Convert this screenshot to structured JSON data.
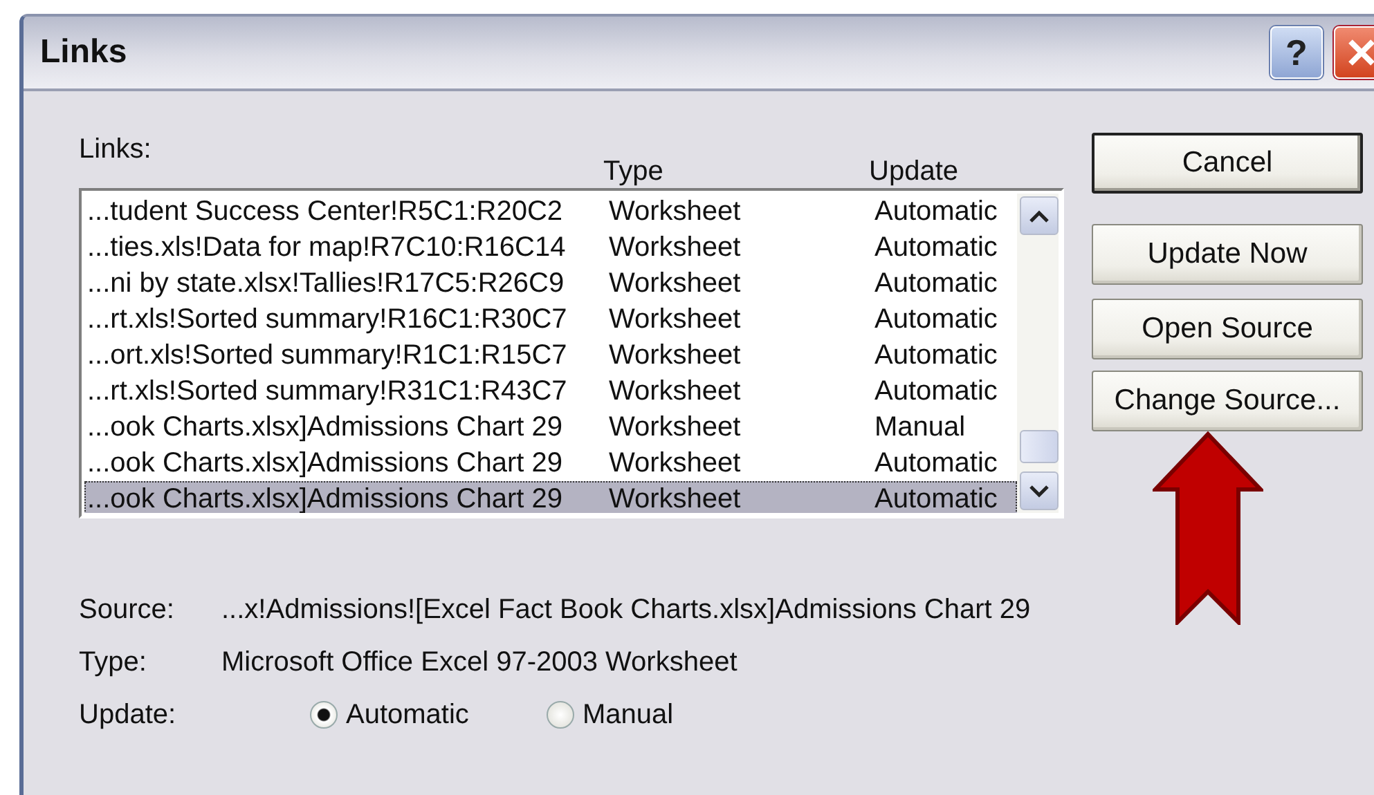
{
  "window": {
    "title": "Links",
    "help_button": "?"
  },
  "links_list": {
    "label": "Links:",
    "columns": [
      "Type",
      "Update"
    ],
    "rows": [
      {
        "link": "...tudent Success Center!R5C1:R20C2",
        "type": "Worksheet",
        "update": "Automatic",
        "selected": false
      },
      {
        "link": "...ties.xls!Data for map!R7C10:R16C14",
        "type": "Worksheet",
        "update": "Automatic",
        "selected": false
      },
      {
        "link": "...ni by state.xlsx!Tallies!R17C5:R26C9",
        "type": "Worksheet",
        "update": "Automatic",
        "selected": false
      },
      {
        "link": "...rt.xls!Sorted summary!R16C1:R30C7",
        "type": "Worksheet",
        "update": "Automatic",
        "selected": false
      },
      {
        "link": "...ort.xls!Sorted summary!R1C1:R15C7",
        "type": "Worksheet",
        "update": "Automatic",
        "selected": false
      },
      {
        "link": "...rt.xls!Sorted summary!R31C1:R43C7",
        "type": "Worksheet",
        "update": "Automatic",
        "selected": false
      },
      {
        "link": "...ook Charts.xlsx]Admissions Chart 29",
        "type": "Worksheet",
        "update": "Manual",
        "selected": false
      },
      {
        "link": "...ook Charts.xlsx]Admissions Chart 29",
        "type": "Worksheet",
        "update": "Automatic",
        "selected": false
      },
      {
        "link": "...ook Charts.xlsx]Admissions Chart 29",
        "type": "Worksheet",
        "update": "Automatic",
        "selected": true
      }
    ]
  },
  "buttons": [
    {
      "label": "Cancel",
      "default": true
    },
    {
      "label": "Update Now",
      "default": false
    },
    {
      "label": "Open Source",
      "default": false
    },
    {
      "label": "Change Source...",
      "default": false
    }
  ],
  "details": [
    {
      "label": "Source:",
      "value": "...x!Admissions![Excel Fact Book Charts.xlsx]Admissions Chart 29"
    },
    {
      "label": "Type:",
      "value": "Microsoft Office Excel 97-2003 Worksheet"
    }
  ],
  "update_option": {
    "label": "Update:",
    "options": [
      {
        "label": "Automatic",
        "selected": true
      },
      {
        "label": "Manual",
        "selected": false
      }
    ]
  }
}
